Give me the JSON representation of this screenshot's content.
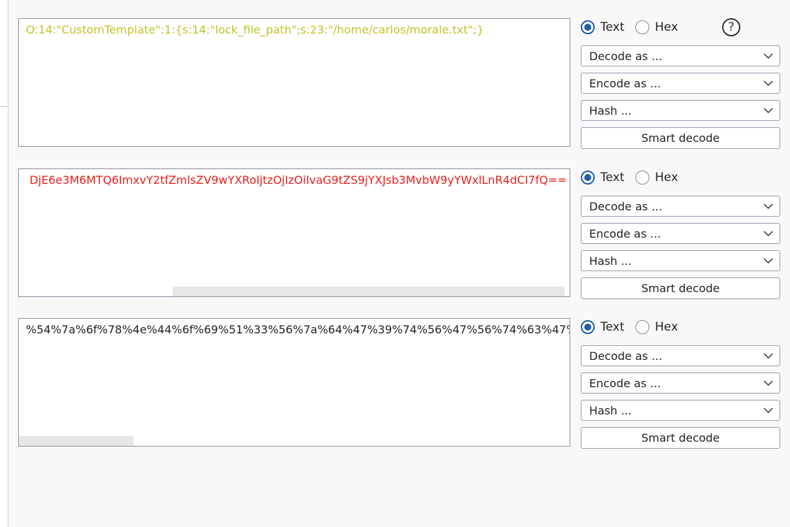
{
  "colors": {
    "text_yellow": "#c5c12a",
    "text_red": "#e8201d",
    "text_black": "#222222",
    "radio_selected": "#1f5fa8"
  },
  "help_icon": {
    "glyph": "?",
    "icon": "help-icon"
  },
  "panels": [
    {
      "content": "O:14:\"CustomTemplate\":1:{s:14:\"lock_file_path\";s:23:\"/home/carlos/morale.txt\";}",
      "radio_text": "Text",
      "radio_hex": "Hex",
      "selected": "Text",
      "decode_label": "Decode as ...",
      "encode_label": "Encode as ...",
      "hash_label": "Hash ...",
      "smart_label": "Smart decode"
    },
    {
      "content": "DjE6e3M6MTQ6ImxvY2tfZmlsZV9wYXRoIjtzOjIzOiIvaG9tZS9jYXJsb3MvbW9yYWxlLnR4dCI7fQ==",
      "radio_text": "Text",
      "radio_hex": "Hex",
      "selected": "Text",
      "decode_label": "Decode as ...",
      "encode_label": "Encode as ...",
      "hash_label": "Hash ...",
      "smart_label": "Smart decode"
    },
    {
      "content": "%54%7a%6f%78%4e%44%6f%69%51%33%56%7a%64%47%39%74%56%47%56%74%63%47%7",
      "radio_text": "Text",
      "radio_hex": "Hex",
      "selected": "Text",
      "decode_label": "Decode as ...",
      "encode_label": "Encode as ...",
      "hash_label": "Hash ...",
      "smart_label": "Smart decode"
    }
  ]
}
